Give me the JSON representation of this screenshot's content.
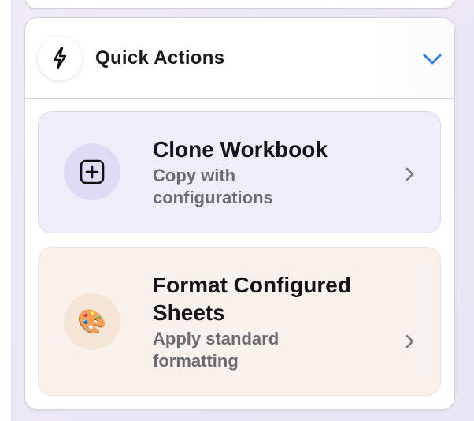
{
  "panel": {
    "title": "Quick Actions",
    "header_icon": "lightning-bolt-icon",
    "toggle_icon": "chevron-down-icon",
    "accent_color": "#2f7cf6"
  },
  "actions": [
    {
      "title": "Clone Workbook",
      "subtitle": "Copy with configurations",
      "icon": "plus-square-icon",
      "card_color": "#efedfa",
      "icon_bg_color": "#dedbf6"
    },
    {
      "title": "Format Configured Sheets",
      "subtitle": "Apply standard formatting",
      "icon": "artist-palette-icon",
      "icon_glyph": "🎨",
      "card_color": "#f8f1ec",
      "icon_bg_color": "#f4e5d6"
    }
  ]
}
